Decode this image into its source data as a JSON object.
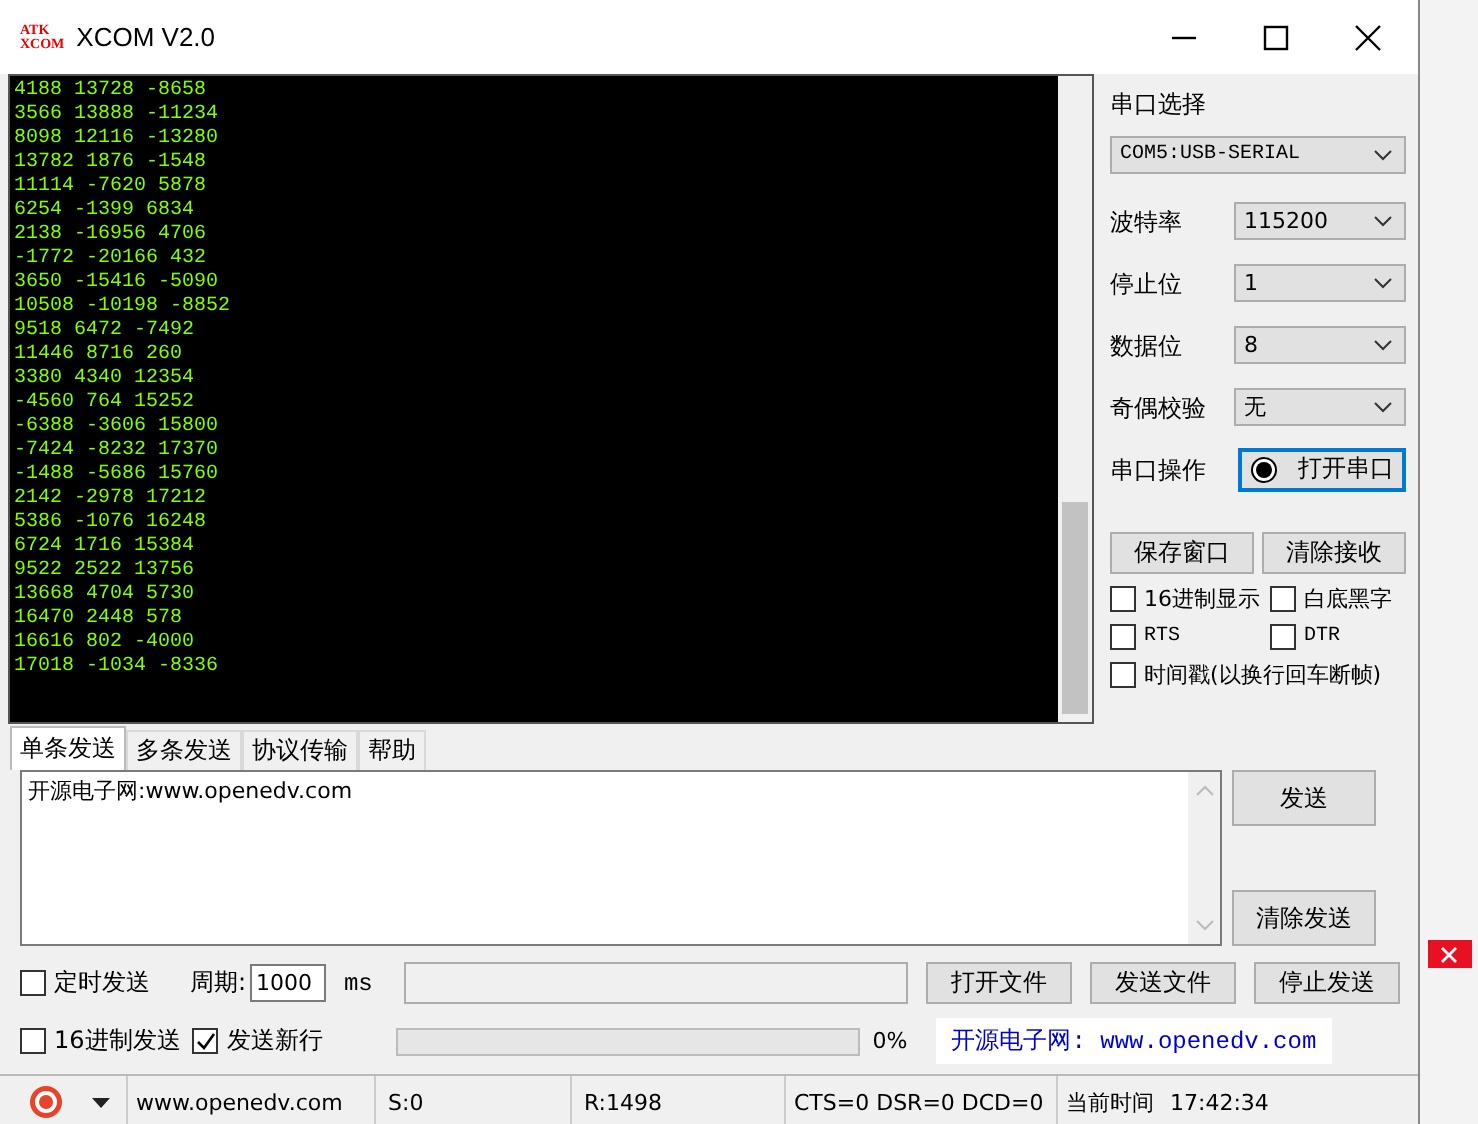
{
  "window": {
    "title": "XCOM V2.0",
    "logo_top": "ATK",
    "logo_bottom": "XCOM"
  },
  "receive": {
    "lines": [
      "4188 13728 -8658",
      "3566 13888 -11234",
      "8098 12116 -13280",
      "13782 1876 -1548",
      "11114 -7620 5878",
      "6254 -1399 6834",
      "2138 -16956 4706",
      "-1772 -20166 432",
      "3650 -15416 -5090",
      "10508 -10198 -8852",
      "9518 6472 -7492",
      "11446 8716 260",
      "3380 4340 12354",
      "-4560 764 15252",
      "-6388 -3606 15800",
      "-7424 -8232 17370",
      "-1488 -5686 15760",
      "2142 -2978 17212",
      "5386 -1076 16248",
      "6724 1716 15384",
      "9522 2522 13756",
      "13668 4704 5730",
      "16470 2448 578",
      "16616 802 -4000",
      "17018 -1034 -8336"
    ]
  },
  "settings": {
    "port_label": "串口选择",
    "port_value": "COM5:USB-SERIAL",
    "fields": [
      {
        "label": "波特率",
        "value": "115200"
      },
      {
        "label": "停止位",
        "value": "1"
      },
      {
        "label": "数据位",
        "value": "8"
      },
      {
        "label": "奇偶校验",
        "value": "无"
      }
    ],
    "operation_label": "串口操作",
    "operation_button": "打开串口",
    "buttons": [
      "保存窗口",
      "清除接收"
    ],
    "checkboxes": [
      {
        "label": "16进制显示",
        "checked": false
      },
      {
        "label": "白底黑字",
        "checked": false
      },
      {
        "label": "RTS",
        "checked": false
      },
      {
        "label": "DTR",
        "checked": false
      },
      {
        "label": "时间戳(以换行回车断帧)",
        "checked": false
      }
    ]
  },
  "send_tabs": [
    {
      "label": "单条发送",
      "selected": true
    },
    {
      "label": "多条发送",
      "selected": false
    },
    {
      "label": "协议传输",
      "selected": false
    },
    {
      "label": "帮助",
      "selected": false
    }
  ],
  "send": {
    "text": "开源电子网:www.openedv.com",
    "buttons": [
      "发送",
      "清除发送"
    ]
  },
  "controls": {
    "timed_send": {
      "label": "定时发送",
      "checked": false
    },
    "period_label": "周期:",
    "period_value": "1000",
    "unit": "ms",
    "file_buttons": [
      "打开文件",
      "发送文件",
      "停止发送"
    ],
    "hex_send": {
      "label": "16进制发送",
      "checked": false
    },
    "new_line": {
      "label": "发送新行",
      "checked": true
    },
    "progress": {
      "level": 0
    },
    "percent": "0%",
    "link": "开源电子网: www.openedv.com"
  },
  "status_bar": {
    "site": "www.openedv.com",
    "sent": "S:0",
    "received": "R:1498",
    "lines": "CTS=0 DSR=0 DCD=0",
    "time_label": "当前时间",
    "time": "17:42:34"
  }
}
